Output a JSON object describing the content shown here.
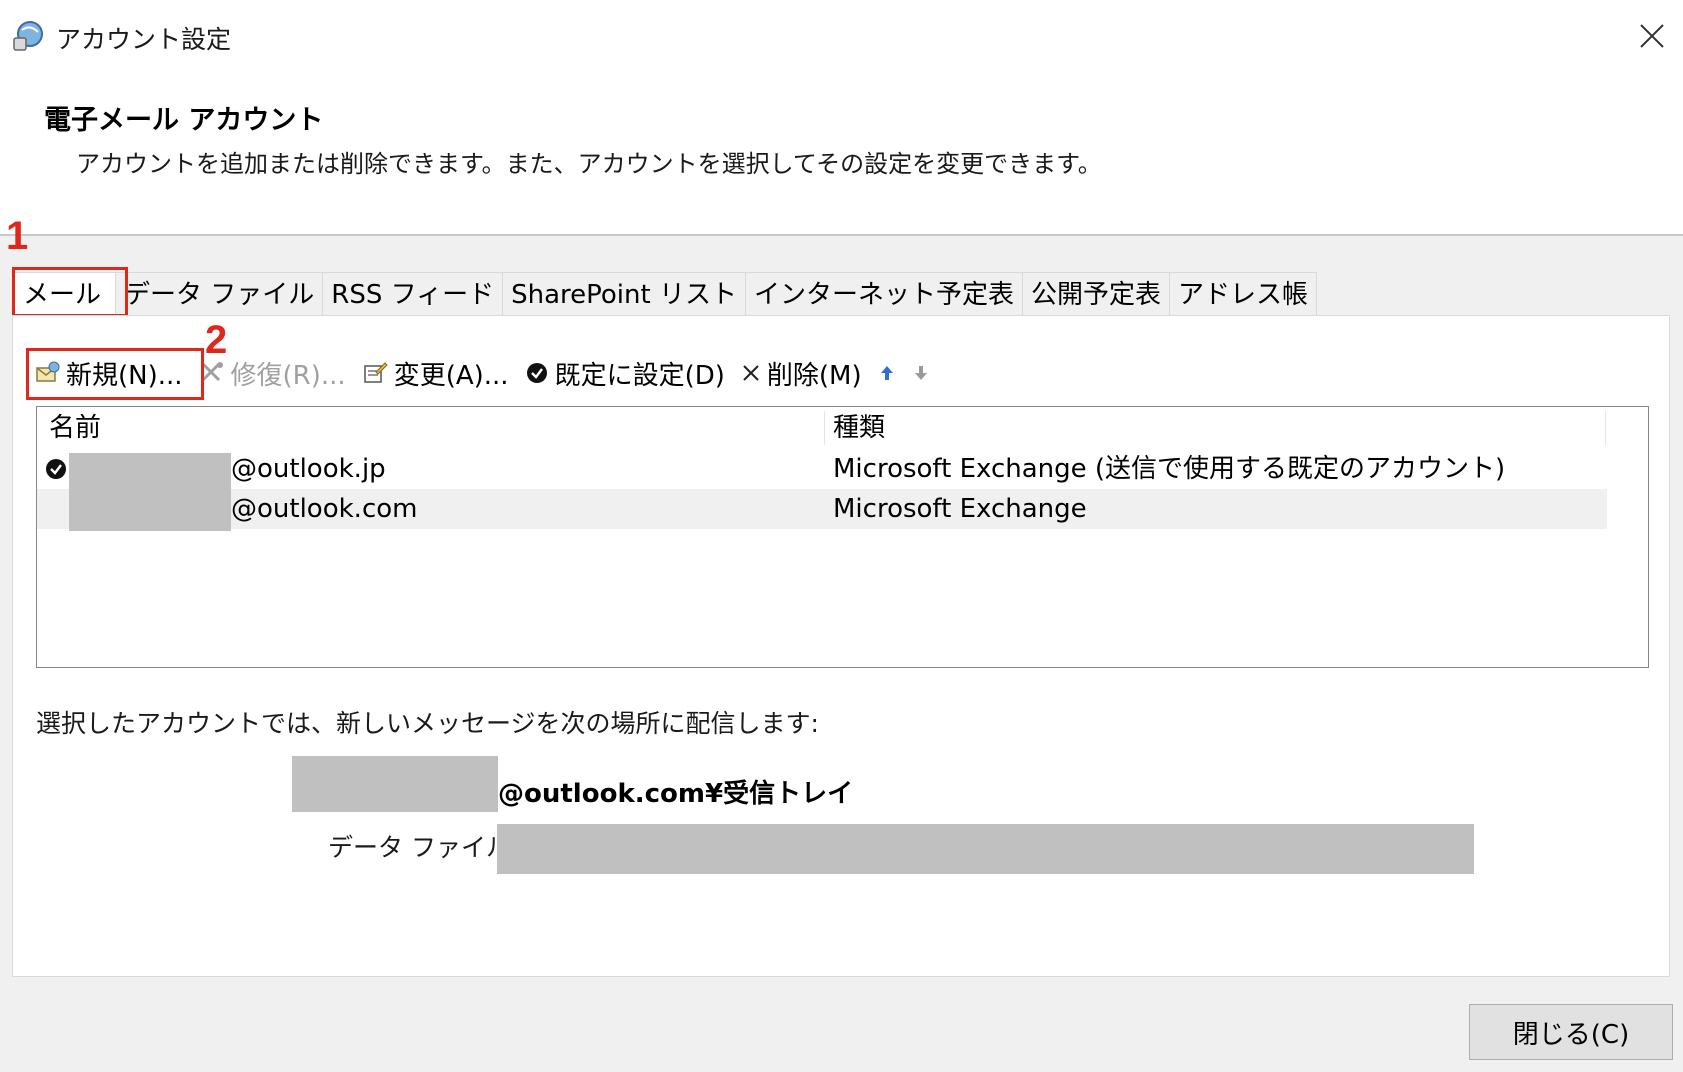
{
  "window": {
    "title": "アカウント設定",
    "close_icon": "close-icon"
  },
  "header": {
    "title": "電子メール アカウント",
    "subtitle": "アカウントを追加または削除できます。また、アカウントを選択してその設定を変更できます。"
  },
  "annotations": {
    "step1": "1",
    "step2": "2",
    "color": "#e0271c"
  },
  "tabs": [
    {
      "label": "メール",
      "active": true
    },
    {
      "label": "データ ファイル"
    },
    {
      "label": "RSS フィード"
    },
    {
      "label": "SharePoint リスト"
    },
    {
      "label": "インターネット予定表"
    },
    {
      "label": "公開予定表"
    },
    {
      "label": "アドレス帳"
    }
  ],
  "toolbar": {
    "new_label": "新規(N)...",
    "repair_label": "修復(R)...",
    "change_label": "変更(A)...",
    "set_default_label": "既定に設定(D)",
    "delete_label": "削除(M)",
    "move_up_icon": "arrow-up-icon",
    "move_down_icon": "arrow-down-icon"
  },
  "list": {
    "col_name": "名前",
    "col_type": "種類",
    "rows": [
      {
        "name": "@outlook.jp",
        "type": "Microsoft Exchange (送信で使用する既定のアカウント)",
        "default": true
      },
      {
        "name": "@outlook.com",
        "type": "Microsoft Exchange",
        "default": false
      }
    ]
  },
  "delivery": {
    "text": "選択したアカウントでは、新しいメッセージを次の場所に配信します:",
    "folder": "@outlook.com¥受信トレイ",
    "datafile_label": "データ ファイル:"
  },
  "footer": {
    "close_label": "閉じる(C)"
  }
}
